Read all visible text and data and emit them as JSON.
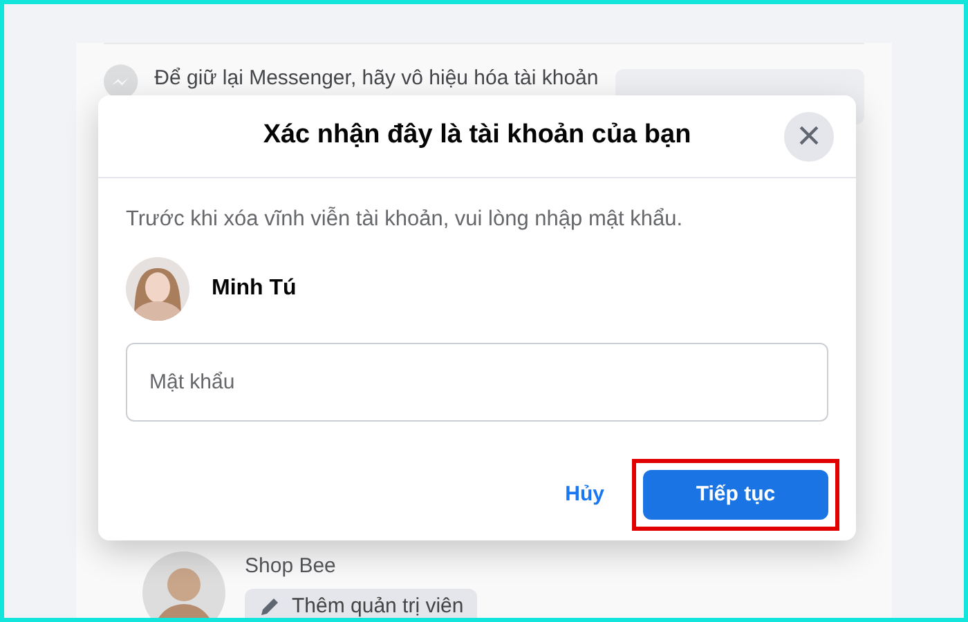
{
  "background": {
    "messenger_note": "Để giữ lại Messenger, hãy vô hiệu hóa tài khoản",
    "page_name": "Shop Bee",
    "add_admin_button": "Thêm quản trị viên"
  },
  "dialog": {
    "title": "Xác nhận đây là tài khoản của bạn",
    "close": "×",
    "message": "Trước khi xóa vĩnh viễn tài khoản, vui lòng nhập mật khẩu.",
    "user_name": "Minh Tú",
    "password": {
      "placeholder": "Mật khẩu"
    },
    "buttons": [
      {
        "kind": "link",
        "label": "Hủy",
        "highlighted": false
      },
      {
        "kind": "primary",
        "label": "Tiếp tục",
        "highlighted": true
      }
    ]
  }
}
